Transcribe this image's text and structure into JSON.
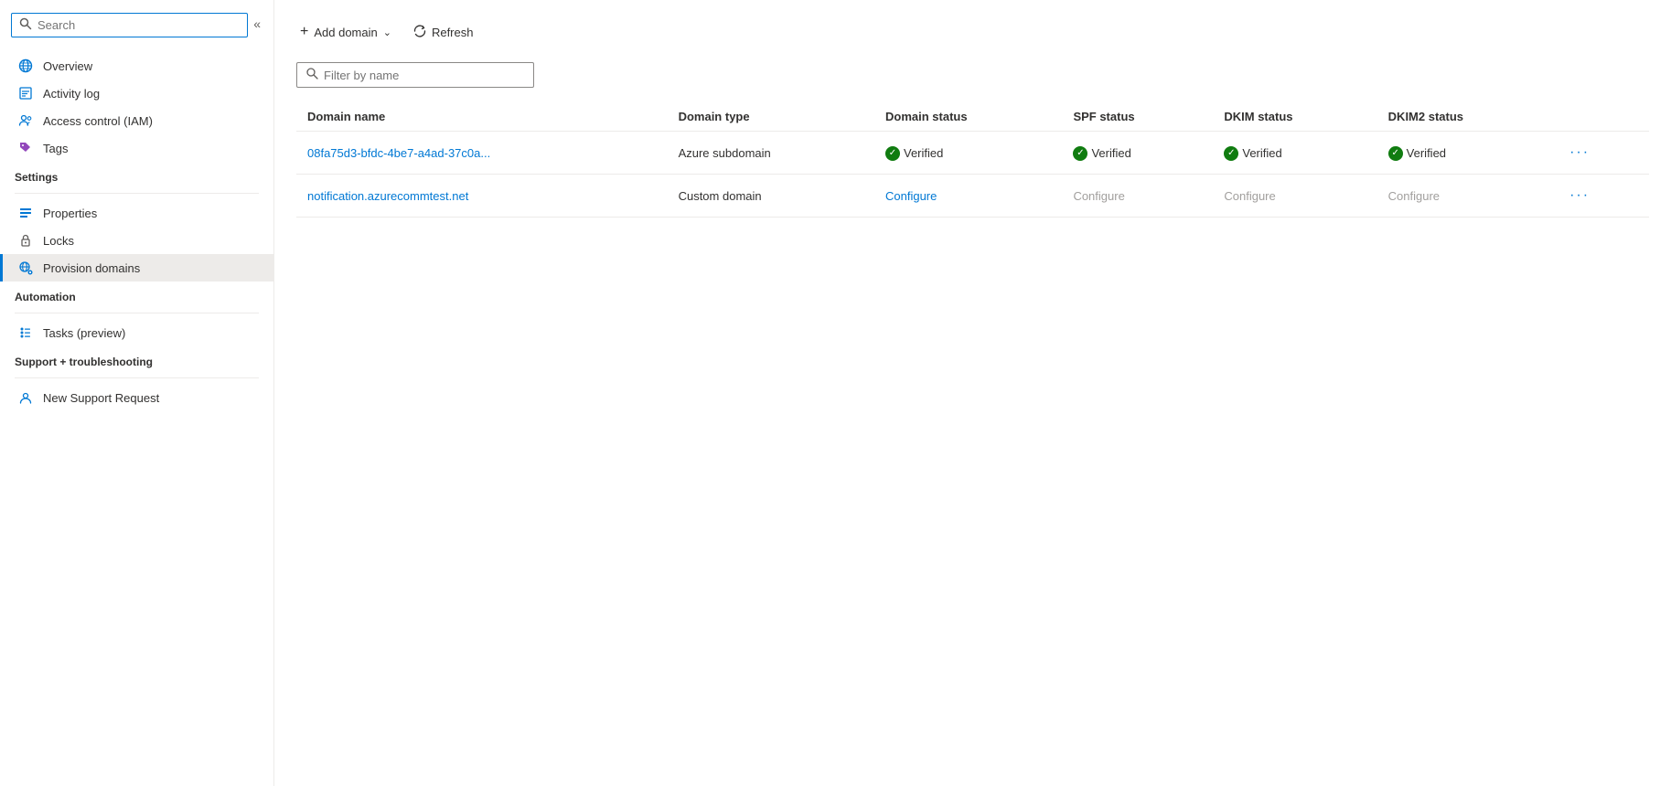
{
  "sidebar": {
    "search_placeholder": "Search",
    "collapse_label": "«",
    "nav_items": [
      {
        "id": "overview",
        "label": "Overview",
        "icon": "globe"
      },
      {
        "id": "activity-log",
        "label": "Activity log",
        "icon": "activity"
      },
      {
        "id": "iam",
        "label": "Access control (IAM)",
        "icon": "people"
      },
      {
        "id": "tags",
        "label": "Tags",
        "icon": "tag"
      }
    ],
    "settings_header": "Settings",
    "settings_items": [
      {
        "id": "properties",
        "label": "Properties",
        "icon": "bars"
      },
      {
        "id": "locks",
        "label": "Locks",
        "icon": "lock"
      },
      {
        "id": "provision-domains",
        "label": "Provision domains",
        "icon": "globe-check",
        "active": true
      }
    ],
    "automation_header": "Automation",
    "automation_items": [
      {
        "id": "tasks",
        "label": "Tasks (preview)",
        "icon": "tasks"
      }
    ],
    "support_header": "Support + troubleshooting",
    "support_items": [
      {
        "id": "new-support",
        "label": "New Support Request",
        "icon": "person-help"
      }
    ]
  },
  "toolbar": {
    "add_domain_label": "Add domain",
    "add_domain_chevron": "∨",
    "refresh_label": "Refresh"
  },
  "filter": {
    "placeholder": "Filter by name"
  },
  "table": {
    "columns": [
      {
        "id": "domain-name",
        "label": "Domain name"
      },
      {
        "id": "domain-type",
        "label": "Domain type"
      },
      {
        "id": "domain-status",
        "label": "Domain status"
      },
      {
        "id": "spf-status",
        "label": "SPF status"
      },
      {
        "id": "dkim-status",
        "label": "DKIM status"
      },
      {
        "id": "dkim2-status",
        "label": "DKIM2 status"
      }
    ],
    "rows": [
      {
        "domain_name": "08fa75d3-bfdc-4be7-a4ad-37c0a...",
        "domain_type": "Azure subdomain",
        "domain_status": "Verified",
        "domain_status_verified": true,
        "spf_status": "Verified",
        "spf_verified": true,
        "dkim_status": "Verified",
        "dkim_verified": true,
        "dkim2_status": "Verified",
        "dkim2_verified": true
      },
      {
        "domain_name": "notification.azurecommtest.net",
        "domain_type": "Custom domain",
        "domain_status": "Configure",
        "domain_status_link": true,
        "spf_status": "Configure",
        "spf_verified": false,
        "dkim_status": "Configure",
        "dkim_verified": false,
        "dkim2_status": "Configure",
        "dkim2_verified": false
      }
    ]
  }
}
